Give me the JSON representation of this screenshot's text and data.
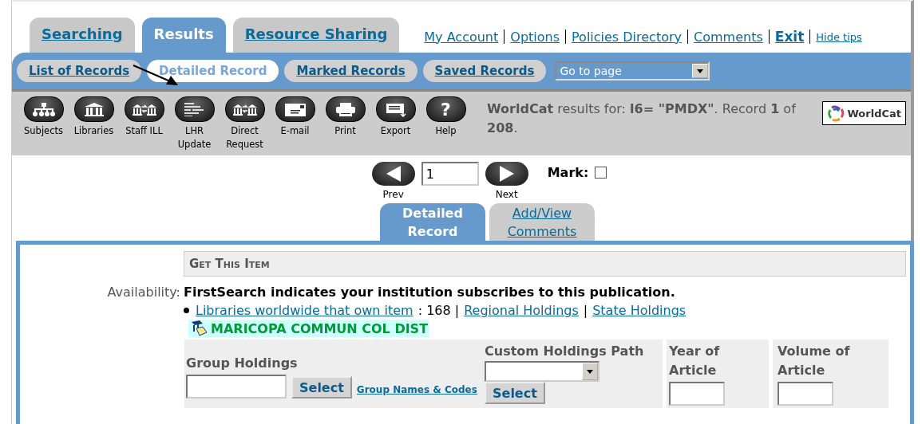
{
  "main_tabs": [
    {
      "label": "Searching",
      "selected": false
    },
    {
      "label": "Results",
      "selected": true
    },
    {
      "label": "Resource Sharing",
      "selected": false
    }
  ],
  "top_links": [
    {
      "label": "My Account",
      "kind": "link"
    },
    {
      "label": "Options",
      "kind": "link"
    },
    {
      "label": "Policies Directory",
      "kind": "link"
    },
    {
      "label": "Comments",
      "kind": "link"
    },
    {
      "label": "Exit",
      "kind": "bold"
    },
    {
      "label": "Hide tips",
      "kind": "small"
    }
  ],
  "sub_tabs": [
    {
      "label": "List of Records",
      "selected": false
    },
    {
      "label": "Detailed Record",
      "selected": true
    },
    {
      "label": "Marked Records",
      "selected": false
    },
    {
      "label": "Saved Records",
      "selected": false
    }
  ],
  "goto_select": {
    "value": "Go to page"
  },
  "toolbar": {
    "buttons": [
      {
        "label": "Subjects",
        "kind": "icon"
      },
      {
        "label": "Libraries",
        "kind": "icon"
      },
      {
        "label": "Staff ILL",
        "kind": "icon"
      },
      {
        "label": "LHR Update",
        "kind": "icon"
      },
      {
        "label": "Direct Request",
        "kind": "icon"
      },
      {
        "label": "E-mail",
        "kind": "icon"
      },
      {
        "label": "Print",
        "kind": "icon"
      },
      {
        "label": "Export",
        "kind": "icon"
      },
      {
        "label": "Help",
        "kind": "glyph",
        "glyph": "?"
      }
    ],
    "result_text": "**WorldCat** results for: **l6= \"PMDX\"**. Record **1** of **208**.",
    "logo": "WorldCat"
  },
  "pager": {
    "prev": "Prev",
    "page": "1",
    "next": "Next",
    "mark_label": "Mark:",
    "marked": false
  },
  "record_tabs": [
    {
      "label": "Detailed Record",
      "selected": true
    },
    {
      "label": "Add/View Comments",
      "selected": false
    }
  ],
  "section_title": "Get This Item",
  "availability": {
    "label": "Availability:",
    "message": "FirstSearch indicates your institution subscribes to this publication.",
    "segments": [
      {
        "kind": "link",
        "text": "Libraries worldwide that own item"
      },
      {
        "kind": "text",
        "text": ": 168 |"
      },
      {
        "kind": "link",
        "text": "Regional Holdings"
      },
      {
        "kind": "text",
        "text": "|"
      },
      {
        "kind": "link",
        "text": "State Holdings"
      }
    ],
    "institution": "MARICOPA COMMUN COL DIST"
  },
  "holdings_form": {
    "group": {
      "label": "Group Holdings",
      "button": "Select",
      "link": "Group Names & Codes"
    },
    "custom": {
      "label": "Custom Holdings Path",
      "button": "Select"
    },
    "year": {
      "label": "Year of Article"
    },
    "volume": {
      "label": "Volume of Article"
    }
  }
}
